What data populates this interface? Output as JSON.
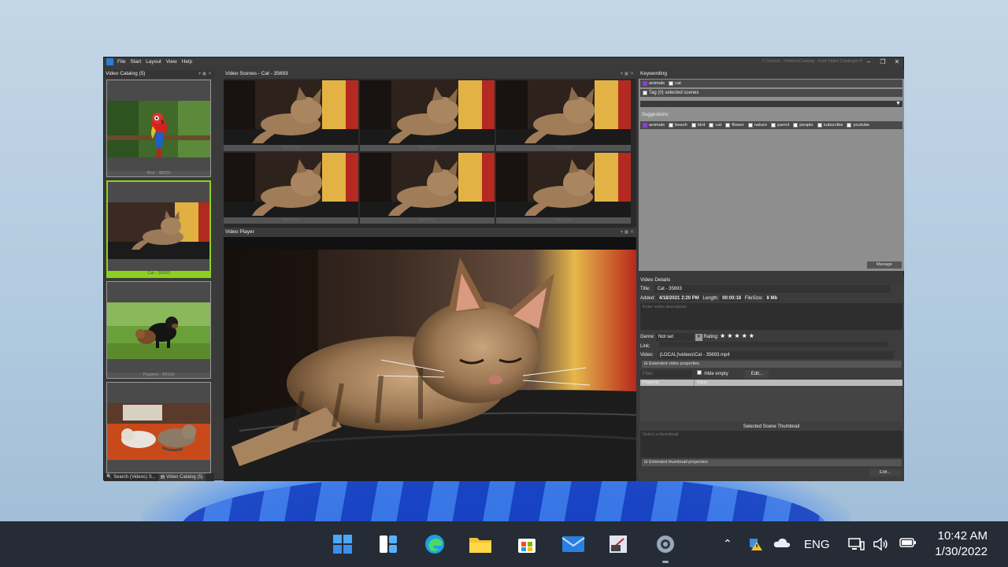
{
  "menu": {
    "items": [
      "File",
      "Start",
      "Layout",
      "View",
      "Help"
    ],
    "window_title": "C:\\Users\\...\\Videos\\Catalog - Fast Video Cataloger 8"
  },
  "catalog": {
    "title": "Video Catalog (5)",
    "items": [
      {
        "caption": "Bird - 48025"
      },
      {
        "caption": "Cat - 35693"
      },
      {
        "caption": "Puppies - 89168"
      },
      {
        "caption": ""
      }
    ],
    "tabs": [
      "Search (Videos) S...",
      "Video Catalog (5)"
    ]
  },
  "scenes": {
    "title": "Video Scenes - Cat - 35693",
    "times": [
      "00:00:03",
      "00:00:05",
      "00:00:08",
      "00:00:10",
      "00:00:13",
      "00:00:16"
    ]
  },
  "player": {
    "title": "Video Player"
  },
  "keywording": {
    "title": "Keywording",
    "tags": [
      "animals",
      "cat"
    ],
    "tag_selected": "Tag (0) selected scenes",
    "suggestions_label": "Suggestions:",
    "suggestions": [
      "animals",
      "beach",
      "bird",
      "cat",
      "flower",
      "nature",
      "parrot",
      "people",
      "subscribe",
      "youtube"
    ],
    "manage_label": "Manage"
  },
  "details": {
    "title": "Video Details",
    "title_label": "Title:",
    "title_value": "Cat - 35693",
    "added_label": "Added:",
    "added_value": "4/18/2021 2:20 PM",
    "length_label": "Length:",
    "length_value": "00:00:18",
    "filesize_label": "FileSize:",
    "filesize_value": "8 Mb",
    "desc_placeholder": "Enter video description",
    "genre_label": "Genre:",
    "genre_value": "Not set",
    "rating_label": "Rating:",
    "rating": 5,
    "link_label": "Link:",
    "video_label": "Video:",
    "video_value": "{LOCAL}\\videos\\Cat - 35693.mp4",
    "ext_props": "Extended video properties",
    "filter_placeholder": "Filter",
    "hide_empty": "Hide empty",
    "edit_label": "Edit...",
    "col_property": "Property",
    "col_value": "Value",
    "thumb_title": "Selected Scene Thumbnail",
    "thumb_placeholder": "Select a thumbnail",
    "ext_thumb_props": "Extended thumbnail properties",
    "thumb_edit_label": "Edit..."
  },
  "taskbar": {
    "lang": "ENG",
    "time": "10:42 AM",
    "date": "1/30/2022"
  }
}
